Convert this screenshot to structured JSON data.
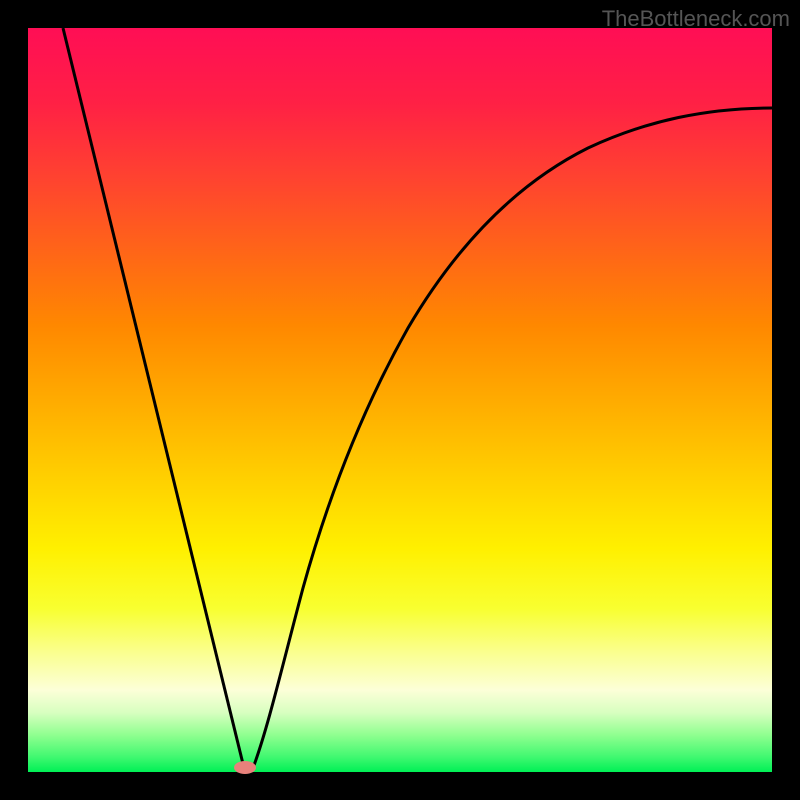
{
  "watermark": "TheBottleneck.com",
  "chart_data": {
    "type": "line",
    "title": "",
    "xlabel": "",
    "ylabel": "",
    "xlim": [
      0,
      100
    ],
    "ylim": [
      0,
      100
    ],
    "background_gradient": {
      "stops": [
        {
          "offset": 0,
          "color": "#ff0e55"
        },
        {
          "offset": 15,
          "color": "#ff2e3f"
        },
        {
          "offset": 30,
          "color": "#ff5f22"
        },
        {
          "offset": 45,
          "color": "#ff9200"
        },
        {
          "offset": 60,
          "color": "#ffc500"
        },
        {
          "offset": 75,
          "color": "#f5f500"
        },
        {
          "offset": 82,
          "color": "#f9ff66"
        },
        {
          "offset": 88,
          "color": "#fcffcc"
        },
        {
          "offset": 92,
          "color": "#d3ffb0"
        },
        {
          "offset": 95,
          "color": "#88ff88"
        },
        {
          "offset": 100,
          "color": "#00f055"
        }
      ]
    },
    "series": [
      {
        "name": "bottleneck-curve",
        "type": "curve",
        "left_branch": {
          "start_x": 5,
          "start_y": 100,
          "end_x": 29,
          "end_y": 0
        },
        "right_branch": {
          "start_x": 31,
          "start_y": 0,
          "points": [
            {
              "x": 35,
              "y": 18
            },
            {
              "x": 40,
              "y": 35
            },
            {
              "x": 50,
              "y": 55
            },
            {
              "x": 60,
              "y": 67
            },
            {
              "x": 70,
              "y": 75
            },
            {
              "x": 80,
              "y": 80
            },
            {
              "x": 90,
              "y": 83
            },
            {
              "x": 100,
              "y": 85
            }
          ]
        }
      }
    ],
    "annotations": [
      {
        "type": "marker",
        "name": "minimum-point",
        "x": 30,
        "y": 0,
        "color": "#e8817b"
      }
    ]
  }
}
